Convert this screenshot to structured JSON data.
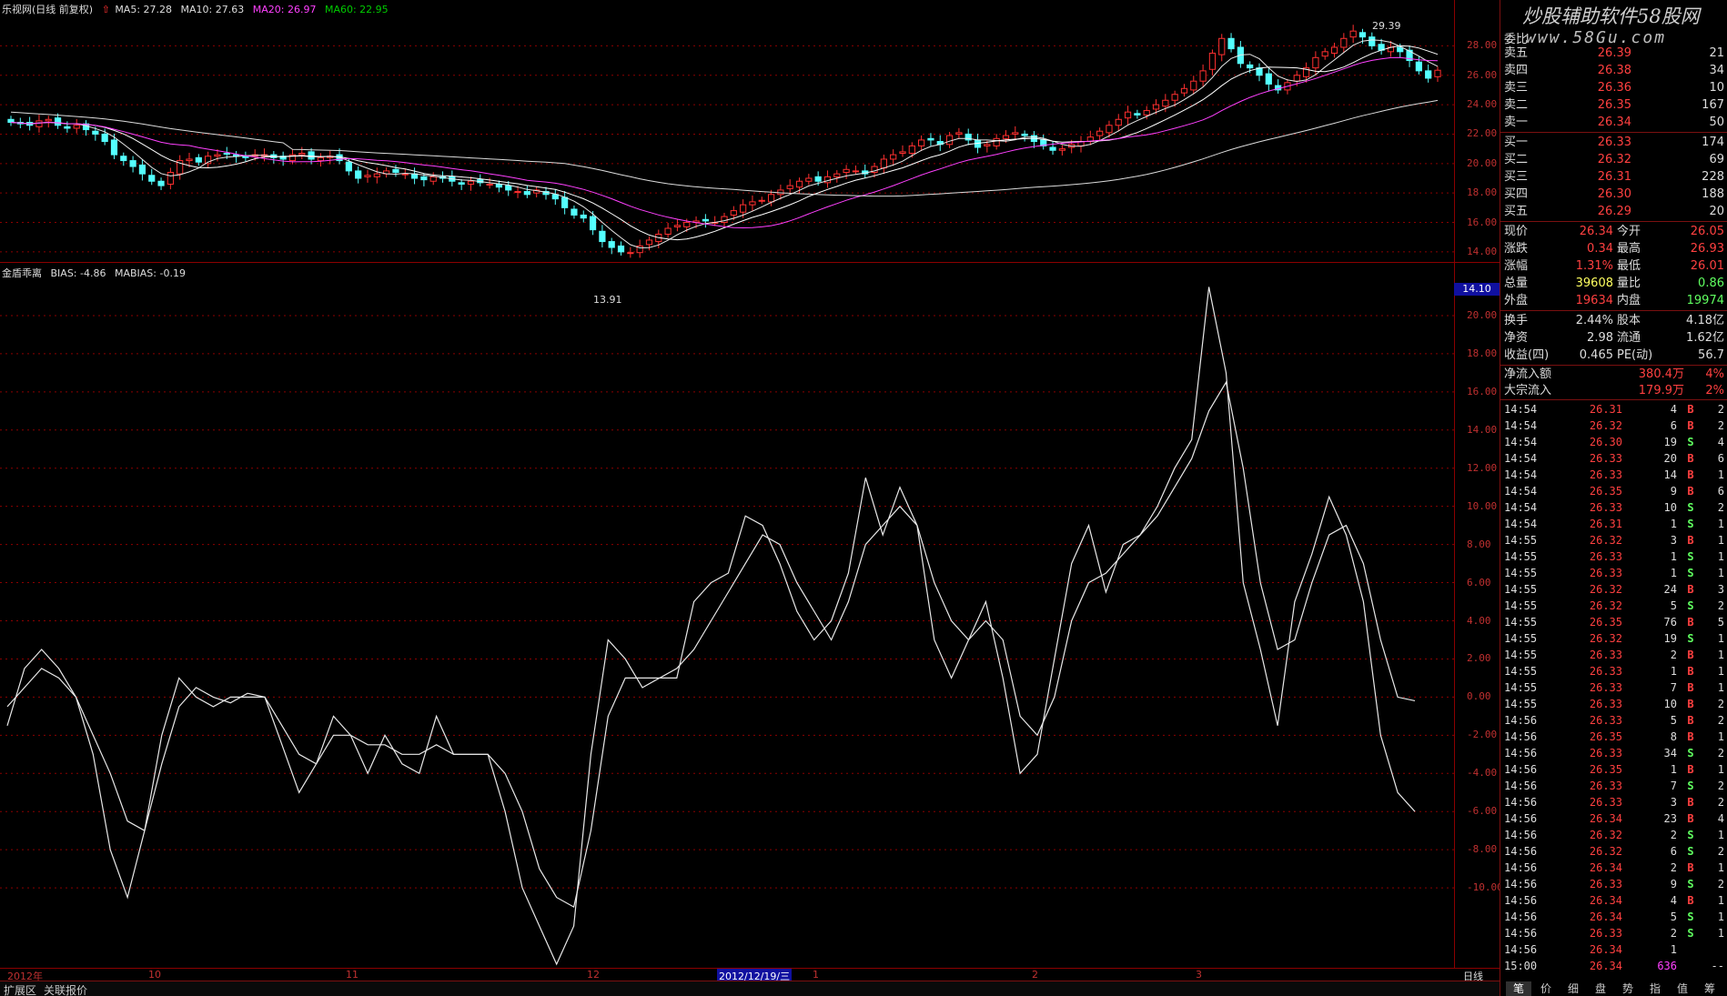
{
  "header": {
    "title": "乐视网(日线 前复权)",
    "ma5": "MA5: 27.28",
    "ma10": "MA10: 27.63",
    "ma20": "MA20: 26.97",
    "ma60": "MA60: 22.95"
  },
  "indicator": {
    "name": "金盾乖离",
    "bias": "BIAS: -4.86",
    "mabias": "MABIAS: -0.19"
  },
  "price_axis": [
    "28.00",
    "26.00",
    "24.00",
    "22.00",
    "20.00",
    "18.00",
    "16.00",
    "14.00"
  ],
  "price_marker": "14.10",
  "bias_axis": [
    "20.00",
    "18.00",
    "16.00",
    "14.00",
    "12.00",
    "10.00",
    "8.00",
    "6.00",
    "4.00",
    "2.00",
    "0.00",
    "-2.00",
    "-4.00",
    "-6.00",
    "-8.00",
    "-10.00"
  ],
  "annotations": {
    "high": "29.39",
    "low": "13.91"
  },
  "x_axis": {
    "labels": [
      "2012年",
      "10",
      "11",
      "12",
      "1",
      "2",
      "3"
    ],
    "selected_date": "2012/12/19/三",
    "period": "日线"
  },
  "bottom_tabs": {
    "left": "扩展区",
    "right": "关联报价"
  },
  "colors": {
    "up": "#ff3030",
    "down": "#54ffff",
    "ma20": "#ff40ff",
    "ma60": "#00cc00",
    "grid": "#8b0000"
  },
  "watermark": {
    "line1": "炒股辅助软件58股网",
    "line2": "www.58Gu.com"
  },
  "order_book": {
    "header": "委比",
    "asks": [
      {
        "label": "卖五",
        "price": "26.39",
        "vol": "21"
      },
      {
        "label": "卖四",
        "price": "26.38",
        "vol": "34"
      },
      {
        "label": "卖三",
        "price": "26.36",
        "vol": "10"
      },
      {
        "label": "卖二",
        "price": "26.35",
        "vol": "167"
      },
      {
        "label": "卖一",
        "price": "26.34",
        "vol": "50"
      }
    ],
    "bids": [
      {
        "label": "买一",
        "price": "26.33",
        "vol": "174"
      },
      {
        "label": "买二",
        "price": "26.32",
        "vol": "69"
      },
      {
        "label": "买三",
        "price": "26.31",
        "vol": "228"
      },
      {
        "label": "买四",
        "price": "26.30",
        "vol": "188"
      },
      {
        "label": "买五",
        "price": "26.29",
        "vol": "20"
      }
    ]
  },
  "quote": [
    {
      "l1": "现价",
      "v1": "26.34",
      "l2": "今开",
      "v2": "26.05"
    },
    {
      "l1": "涨跌",
      "v1": "0.34",
      "l2": "最高",
      "v2": "26.93"
    },
    {
      "l1": "涨幅",
      "v1": "1.31%",
      "l2": "最低",
      "v2": "26.01"
    },
    {
      "l1": "总量",
      "v1": "39608",
      "l2": "量比",
      "v2": "0.86"
    },
    {
      "l1": "外盘",
      "v1": "19634",
      "l2": "内盘",
      "v2": "19974"
    }
  ],
  "stats": [
    {
      "l1": "换手",
      "v1": "2.44%",
      "l2": "股本",
      "v2": "4.18亿"
    },
    {
      "l1": "净资",
      "v1": "2.98",
      "l2": "流通",
      "v2": "1.62亿"
    },
    {
      "l1": "收益(四)",
      "v1": "0.465",
      "l2": "PE(动)",
      "v2": "56.7"
    }
  ],
  "flows": [
    {
      "label": "净流入额",
      "value": "380.4万",
      "pct": "4%"
    },
    {
      "label": "大宗流入",
      "value": "179.9万",
      "pct": "2%"
    }
  ],
  "ticks": [
    {
      "t": "14:54",
      "p": "26.31",
      "v": "4",
      "d": "B",
      "n": "2"
    },
    {
      "t": "14:54",
      "p": "26.32",
      "v": "6",
      "d": "B",
      "n": "2"
    },
    {
      "t": "14:54",
      "p": "26.30",
      "v": "19",
      "d": "S",
      "n": "4"
    },
    {
      "t": "14:54",
      "p": "26.33",
      "v": "20",
      "d": "B",
      "n": "6"
    },
    {
      "t": "14:54",
      "p": "26.33",
      "v": "14",
      "d": "B",
      "n": "1"
    },
    {
      "t": "14:54",
      "p": "26.35",
      "v": "9",
      "d": "B",
      "n": "6"
    },
    {
      "t": "14:54",
      "p": "26.33",
      "v": "10",
      "d": "S",
      "n": "2"
    },
    {
      "t": "14:54",
      "p": "26.31",
      "v": "1",
      "d": "S",
      "n": "1"
    },
    {
      "t": "14:55",
      "p": "26.32",
      "v": "3",
      "d": "B",
      "n": "1"
    },
    {
      "t": "14:55",
      "p": "26.33",
      "v": "1",
      "d": "S",
      "n": "1"
    },
    {
      "t": "14:55",
      "p": "26.33",
      "v": "1",
      "d": "S",
      "n": "1"
    },
    {
      "t": "14:55",
      "p": "26.32",
      "v": "24",
      "d": "B",
      "n": "3"
    },
    {
      "t": "14:55",
      "p": "26.32",
      "v": "5",
      "d": "S",
      "n": "2"
    },
    {
      "t": "14:55",
      "p": "26.35",
      "v": "76",
      "d": "B",
      "n": "5"
    },
    {
      "t": "14:55",
      "p": "26.32",
      "v": "19",
      "d": "S",
      "n": "1"
    },
    {
      "t": "14:55",
      "p": "26.33",
      "v": "2",
      "d": "B",
      "n": "1"
    },
    {
      "t": "14:55",
      "p": "26.33",
      "v": "1",
      "d": "B",
      "n": "1"
    },
    {
      "t": "14:55",
      "p": "26.33",
      "v": "7",
      "d": "B",
      "n": "1"
    },
    {
      "t": "14:55",
      "p": "26.33",
      "v": "10",
      "d": "B",
      "n": "2"
    },
    {
      "t": "14:56",
      "p": "26.33",
      "v": "5",
      "d": "B",
      "n": "2"
    },
    {
      "t": "14:56",
      "p": "26.35",
      "v": "8",
      "d": "B",
      "n": "1"
    },
    {
      "t": "14:56",
      "p": "26.33",
      "v": "34",
      "d": "S",
      "n": "2"
    },
    {
      "t": "14:56",
      "p": "26.35",
      "v": "1",
      "d": "B",
      "n": "1"
    },
    {
      "t": "14:56",
      "p": "26.33",
      "v": "7",
      "d": "S",
      "n": "2"
    },
    {
      "t": "14:56",
      "p": "26.33",
      "v": "3",
      "d": "B",
      "n": "2"
    },
    {
      "t": "14:56",
      "p": "26.34",
      "v": "23",
      "d": "B",
      "n": "4"
    },
    {
      "t": "14:56",
      "p": "26.32",
      "v": "2",
      "d": "S",
      "n": "1"
    },
    {
      "t": "14:56",
      "p": "26.32",
      "v": "6",
      "d": "S",
      "n": "2"
    },
    {
      "t": "14:56",
      "p": "26.34",
      "v": "2",
      "d": "B",
      "n": "1"
    },
    {
      "t": "14:56",
      "p": "26.33",
      "v": "9",
      "d": "S",
      "n": "2"
    },
    {
      "t": "14:56",
      "p": "26.34",
      "v": "4",
      "d": "B",
      "n": "1"
    },
    {
      "t": "14:56",
      "p": "26.34",
      "v": "5",
      "d": "S",
      "n": "1"
    },
    {
      "t": "14:56",
      "p": "26.33",
      "v": "2",
      "d": "S",
      "n": "1"
    },
    {
      "t": "14:56",
      "p": "26.34",
      "v": "1",
      "d": "",
      "n": ""
    },
    {
      "t": "15:00",
      "p": "26.34",
      "v": "636",
      "d": "",
      "n": "--"
    }
  ],
  "right_tabs": [
    "笔",
    "价",
    "细",
    "盘",
    "势",
    "指",
    "值",
    "筹"
  ],
  "chart_data": {
    "type": "line",
    "price": {
      "ylim": [
        13.5,
        30
      ],
      "close": [
        22.8,
        22.7,
        22.6,
        22.9,
        23.0,
        22.6,
        22.4,
        22.6,
        22.3,
        22.0,
        21.5,
        20.6,
        20.2,
        19.8,
        19.3,
        18.8,
        18.5,
        19.4,
        20.2,
        20.3,
        20.1,
        20.5,
        20.6,
        20.7,
        20.5,
        20.4,
        20.6,
        20.6,
        20.4,
        20.3,
        20.6,
        20.7,
        20.3,
        20.4,
        20.5,
        20.2,
        19.5,
        19.0,
        19.2,
        19.3,
        19.5,
        19.4,
        19.3,
        19.0,
        18.9,
        19.1,
        19.0,
        18.8,
        18.6,
        18.8,
        18.7,
        18.6,
        18.4,
        18.2,
        18.1,
        17.9,
        18.2,
        17.9,
        17.6,
        17.0,
        16.5,
        16.3,
        15.5,
        14.7,
        14.3,
        14.0,
        13.95,
        14.4,
        14.8,
        15.2,
        15.6,
        15.8,
        16.0,
        16.1,
        16.1,
        16.0,
        16.4,
        16.8,
        17.2,
        17.4,
        17.5,
        17.9,
        18.2,
        18.5,
        18.8,
        19.0,
        18.8,
        19.1,
        19.3,
        19.6,
        19.5,
        19.3,
        19.8,
        20.3,
        20.6,
        20.8,
        21.2,
        21.6,
        21.6,
        21.3,
        21.9,
        22.1,
        21.6,
        21.1,
        21.3,
        21.7,
        21.9,
        22.1,
        21.9,
        21.5,
        21.2,
        20.9,
        21.0,
        21.3,
        21.5,
        21.8,
        22.2,
        22.6,
        23.0,
        23.5,
        23.3,
        23.6,
        24.0,
        24.3,
        24.7,
        25.1,
        25.6,
        26.3,
        27.5,
        28.5,
        27.8,
        26.8,
        26.5,
        26.0,
        25.4,
        25.0,
        25.5,
        26.0,
        26.5,
        27.2,
        27.6,
        27.9,
        28.5,
        29.0,
        28.6,
        28.0,
        27.7,
        27.9,
        27.6,
        27.0,
        26.3,
        25.8,
        26.34
      ],
      "ma60_end": 22.95
    },
    "bias": {
      "ylim": [
        -14,
        22
      ],
      "bias": [
        -1.5,
        1.5,
        2.5,
        1.5,
        0,
        -3,
        -8,
        -10.5,
        -7,
        -2,
        1,
        0,
        -0.5,
        0,
        0,
        0,
        -2.5,
        -5,
        -3.5,
        -1,
        -2,
        -4,
        -2,
        -3.5,
        -4,
        -1,
        -3,
        -3,
        -3,
        -6,
        -10,
        -12,
        -14,
        -12,
        -3,
        3,
        2,
        0.5,
        1,
        1,
        5,
        6,
        6.5,
        9.5,
        9,
        7,
        4.5,
        3,
        4,
        6.5,
        11.5,
        8.5,
        11,
        9,
        3,
        1,
        3,
        5,
        1,
        -4,
        -3,
        2,
        7,
        9,
        5.5,
        8,
        8.5,
        10,
        12,
        13.5,
        21.5,
        17,
        6,
        2.5,
        -1.5,
        5,
        7.5,
        10.5,
        8.5,
        5,
        -2,
        -5,
        -6
      ],
      "mabias": [
        -0.5,
        0.5,
        1.5,
        1,
        0,
        -2,
        -4,
        -6.5,
        -7,
        -3.5,
        -0.5,
        0.5,
        0,
        -0.3,
        0.2,
        0,
        -1.5,
        -3,
        -3.5,
        -2,
        -2,
        -2.5,
        -2.5,
        -3,
        -3,
        -2.5,
        -3,
        -3,
        -3,
        -4,
        -6,
        -9,
        -10.5,
        -11,
        -7,
        -1,
        1,
        1,
        1,
        1.5,
        2.5,
        4,
        5.5,
        7,
        8.5,
        8,
        6,
        4.5,
        3,
        5,
        8,
        9,
        10,
        9,
        6,
        4,
        3,
        4,
        3,
        -1,
        -2,
        0,
        4,
        6,
        6.5,
        7.5,
        8.5,
        9.5,
        11,
        12.5,
        15,
        16.5,
        12,
        6,
        2.5,
        3,
        6,
        8.5,
        9,
        7,
        3,
        0,
        -0.19
      ]
    }
  }
}
